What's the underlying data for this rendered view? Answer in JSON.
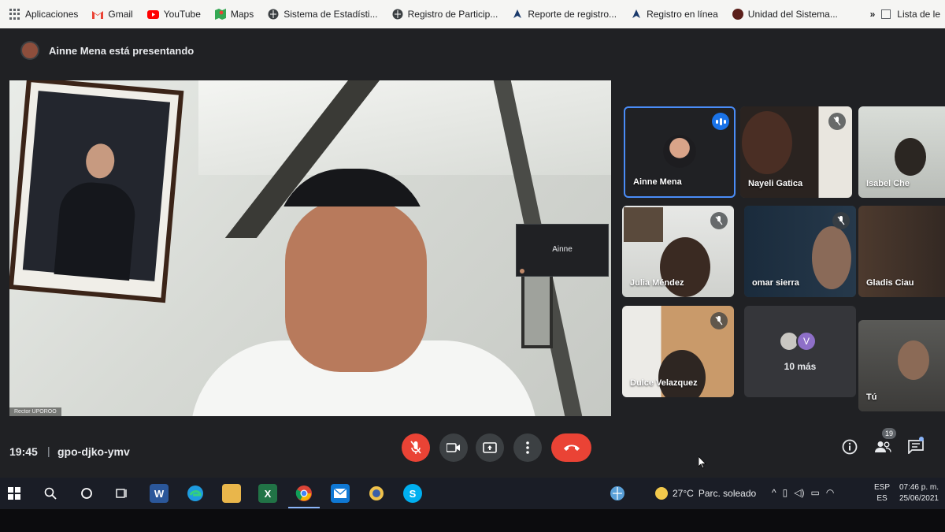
{
  "browser": {
    "bookmarks": [
      {
        "label": "Aplicaciones",
        "icon": "apps-grid-icon"
      },
      {
        "label": "Gmail",
        "icon": "gmail-icon",
        "color": "#ea4335"
      },
      {
        "label": "YouTube",
        "icon": "youtube-icon",
        "color": "#ff0000"
      },
      {
        "label": "Maps",
        "icon": "maps-icon",
        "color": "#34a853"
      },
      {
        "label": "Sistema de Estadísti...",
        "icon": "globe-icon",
        "color": "#3c4043"
      },
      {
        "label": "Registro de Particip...",
        "icon": "globe-icon",
        "color": "#3c4043"
      },
      {
        "label": "Reporte de registro...",
        "icon": "bookmark-site-icon",
        "color": "#1a3a6b"
      },
      {
        "label": "Registro en línea",
        "icon": "bookmark-site-icon",
        "color": "#1a3a6b"
      },
      {
        "label": "Unidad del Sistema...",
        "icon": "site-icon",
        "color": "#5b1f1a"
      }
    ],
    "overflow": "»",
    "reading_list": "Lista de le"
  },
  "meet": {
    "presenting_text": "Ainne Mena está presentando",
    "main_caption": "Rector UPOROO",
    "pip_name": "Ainne",
    "participants": {
      "ainne": "Ainne Mena",
      "nayeli": "Nayeli Gatica",
      "isabel": "Isabel Che",
      "julia": "Julia Méndez",
      "omar": "omar sierra",
      "gladis": "Gladis Ciau",
      "dulce": "Dulce Velazquez",
      "tu": "Tú"
    },
    "more": {
      "label": "10 más",
      "avatar_letter": "V"
    },
    "time": "19:45",
    "separator": "|",
    "code": "gpo-djko-ymv",
    "people_count": "19",
    "accent": "#1a73e8",
    "danger": "#ea4335"
  },
  "taskbar": {
    "weather_temp": "27°C",
    "weather_text": "Parc. soleado",
    "lang_top": "ESP",
    "lang_bottom": "ES",
    "time": "07:46 p. m.",
    "date": "25/06/2021"
  }
}
